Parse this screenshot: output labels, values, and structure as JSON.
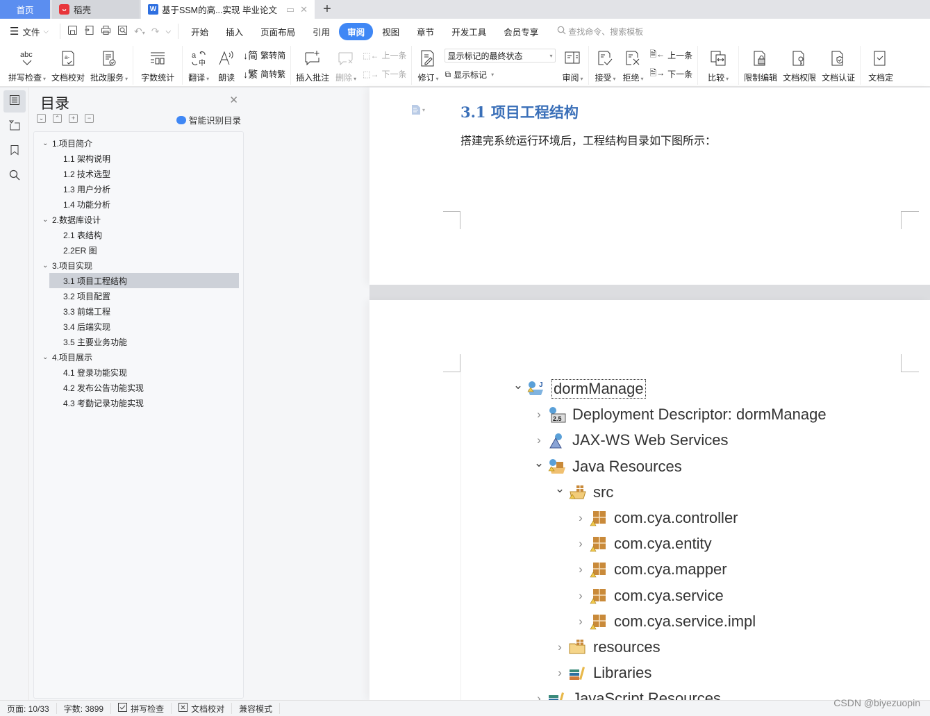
{
  "tabs": {
    "home": "首页",
    "daoke": "稻壳",
    "document": "基于SSM的高...实现 毕业论文",
    "new_tab": "+"
  },
  "menu": {
    "file": "文件",
    "tabs": [
      "开始",
      "插入",
      "页面布局",
      "引用",
      "审阅",
      "视图",
      "章节",
      "开发工具",
      "会员专享"
    ],
    "active_tab": "审阅",
    "search_placeholder": "查找命令、搜索模板"
  },
  "ribbon": {
    "spell_check": "拼写检查",
    "doc_proofread": "文档校对",
    "correction_service": "批改服务",
    "word_count": "字数统计",
    "translate": "翻译",
    "read_aloud": "朗读",
    "trad_to_simp": "繁转简",
    "simp_to_trad": "简转繁",
    "insert_comment": "插入批注",
    "delete": "删除",
    "prev_comment": "上一条",
    "next_comment": "下一条",
    "track_changes": "修订",
    "markup_mode": "显示标记的最终状态",
    "show_markup": "显示标记",
    "review_pane": "审阅",
    "accept": "接受",
    "reject": "拒绝",
    "prev_change": "上一条",
    "next_change": "下一条",
    "compare": "比较",
    "restrict_editing": "限制编辑",
    "doc_permissions": "文档权限",
    "doc_certification": "文档认证",
    "doc_finalize": "文档定"
  },
  "toc": {
    "title": "目录",
    "smart_recognize": "智能识别目录",
    "items": [
      {
        "label": "1.项目简介",
        "level": 1
      },
      {
        "label": "1.1 架构说明",
        "level": 2
      },
      {
        "label": "1.2 技术选型",
        "level": 2
      },
      {
        "label": "1.3 用户分析",
        "level": 2
      },
      {
        "label": "1.4 功能分析",
        "level": 2
      },
      {
        "label": "2.数据库设计",
        "level": 1
      },
      {
        "label": "2.1 表结构",
        "level": 2
      },
      {
        "label": "2.2ER 图",
        "level": 2
      },
      {
        "label": "3.项目实现",
        "level": 1
      },
      {
        "label": "3.1 项目工程结构",
        "level": 2,
        "selected": true
      },
      {
        "label": "3.2 项目配置",
        "level": 2
      },
      {
        "label": "3.3 前端工程",
        "level": 2
      },
      {
        "label": "3.4 后端实现",
        "level": 2
      },
      {
        "label": "3.5 主要业务功能",
        "level": 2
      },
      {
        "label": "4.项目展示",
        "level": 1
      },
      {
        "label": "4.1 登录功能实现",
        "level": 2
      },
      {
        "label": "4.2 发布公告功能实现",
        "level": 2
      },
      {
        "label": "4.3 考勤记录功能实现",
        "level": 2
      }
    ]
  },
  "document": {
    "heading": "3.1 项目工程结构",
    "paragraph": "搭建完系统运行环境后，工程结构目录如下图所示：",
    "project_tree": [
      {
        "label": "dormManage",
        "depth": 0,
        "expanded": true,
        "icon": "project-icon",
        "selected": true
      },
      {
        "label": "Deployment Descriptor: dormManage",
        "depth": 1,
        "expanded": false,
        "icon": "deployment-descriptor-icon"
      },
      {
        "label": "JAX-WS Web Services",
        "depth": 1,
        "expanded": false,
        "icon": "web-services-icon"
      },
      {
        "label": "Java Resources",
        "depth": 1,
        "expanded": true,
        "icon": "java-resources-icon"
      },
      {
        "label": "src",
        "depth": 2,
        "expanded": true,
        "icon": "source-folder-icon"
      },
      {
        "label": "com.cya.controller",
        "depth": 3,
        "expanded": false,
        "icon": "package-icon"
      },
      {
        "label": "com.cya.entity",
        "depth": 3,
        "expanded": false,
        "icon": "package-icon"
      },
      {
        "label": "com.cya.mapper",
        "depth": 3,
        "expanded": false,
        "icon": "package-icon"
      },
      {
        "label": "com.cya.service",
        "depth": 3,
        "expanded": false,
        "icon": "package-icon"
      },
      {
        "label": "com.cya.service.impl",
        "depth": 3,
        "expanded": false,
        "icon": "package-icon"
      },
      {
        "label": "resources",
        "depth": 2,
        "expanded": false,
        "icon": "folder-icon"
      },
      {
        "label": "Libraries",
        "depth": 2,
        "expanded": false,
        "icon": "libraries-icon"
      },
      {
        "label": "JavaScript Resources",
        "depth": 1,
        "expanded": false,
        "icon": "libraries-icon"
      }
    ]
  },
  "status": {
    "page": "页面: 10/33",
    "word_count": "字数: 3899",
    "spell_check": "拼写检查",
    "doc_proofread": "文档校对",
    "compat_mode": "兼容模式"
  },
  "watermark": "CSDN @biyezuopin",
  "colors": {
    "accent": "#3f87f5",
    "home_tab": "#5b8ef0",
    "heading": "#3a6fb8"
  }
}
